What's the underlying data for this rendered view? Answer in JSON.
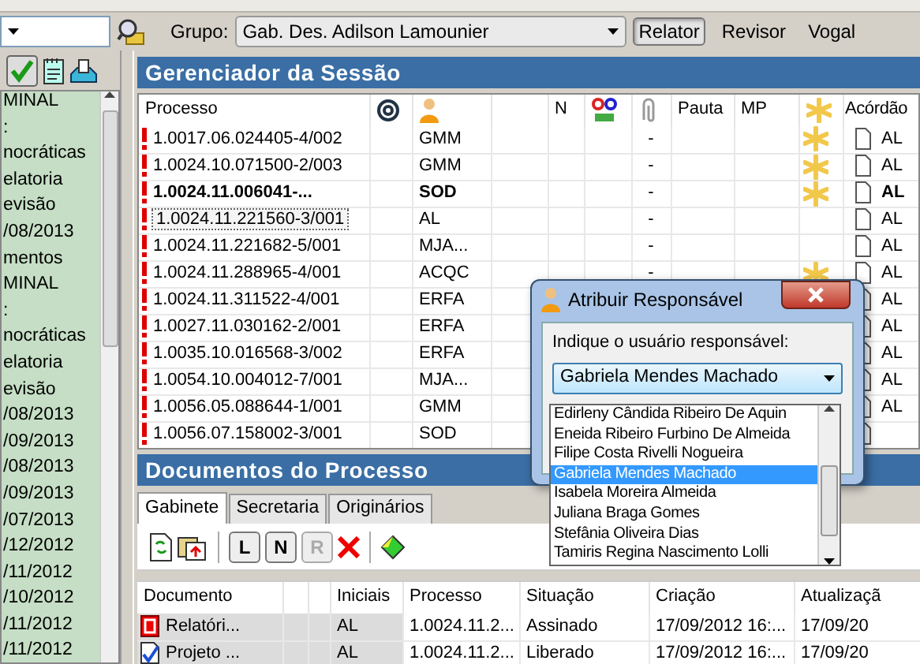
{
  "toolbar": {
    "group_label": "Grupo:",
    "group_value": "Gab. Des. Adilson Lamounier",
    "role_buttons": [
      {
        "label": "Relator",
        "selected": true
      },
      {
        "label": "Revisor",
        "selected": false
      },
      {
        "label": "Vogal",
        "selected": false
      }
    ]
  },
  "sidebar": {
    "check_pressed": true,
    "items": [
      "MINAL",
      ":",
      "nocráticas",
      "elatoria",
      "evisão",
      "/08/2013",
      "mentos",
      "MINAL",
      ":",
      "nocráticas",
      "elatoria",
      "evisão",
      "/08/2013",
      "/09/2013",
      "/08/2013",
      "/09/2013",
      "/07/2013",
      "/12/2012",
      "/11/2012",
      "/10/2012",
      "/11/2012",
      "/11/2012"
    ]
  },
  "session": {
    "title": "Gerenciador da Sessão",
    "columns": [
      {
        "kind": "text",
        "label": "Processo"
      },
      {
        "kind": "email"
      },
      {
        "kind": "person"
      },
      {
        "kind": "blank"
      },
      {
        "kind": "text",
        "label": "N"
      },
      {
        "kind": "acronym"
      },
      {
        "kind": "clip"
      },
      {
        "kind": "text",
        "label": "Pauta"
      },
      {
        "kind": "text",
        "label": "MP"
      },
      {
        "kind": "star"
      },
      {
        "kind": "text",
        "label": "Acórdão"
      }
    ],
    "rows": [
      {
        "process": "1.0017.06.024405-4/002",
        "initials": "GMM",
        "pauta": "-",
        "starred": true,
        "acordao": "AL",
        "bold": false,
        "focused": false
      },
      {
        "process": "1.0024.10.071500-2/003",
        "initials": "GMM",
        "pauta": "-",
        "starred": true,
        "acordao": "AL",
        "bold": false,
        "focused": false
      },
      {
        "process": "1.0024.11.006041-...",
        "initials": "SOD",
        "pauta": "-",
        "starred": true,
        "acordao": "AL",
        "bold": true,
        "focused": false
      },
      {
        "process": "1.0024.11.221560-3/001",
        "initials": "AL",
        "pauta": "-",
        "starred": false,
        "acordao": "AL",
        "bold": false,
        "focused": true
      },
      {
        "process": "1.0024.11.221682-5/001",
        "initials": "MJA...",
        "pauta": "-",
        "starred": false,
        "acordao": "AL",
        "bold": false,
        "focused": false
      },
      {
        "process": "1.0024.11.288965-4/001",
        "initials": "ACQC",
        "pauta": "-",
        "starred": true,
        "acordao": "AL",
        "bold": false,
        "focused": false
      },
      {
        "process": "1.0024.11.311522-4/001",
        "initials": "ERFA",
        "starred": false,
        "acordao": "AL",
        "bold": false,
        "focused": false
      },
      {
        "process": "1.0027.11.030162-2/001",
        "initials": "ERFA",
        "starred": false,
        "acordao": "AL",
        "bold": false,
        "focused": false
      },
      {
        "process": "1.0035.10.016568-3/002",
        "initials": "ERFA",
        "starred": false,
        "acordao": "AL",
        "bold": false,
        "focused": false
      },
      {
        "process": "1.0054.10.004012-7/001",
        "initials": "MJA...",
        "starred": false,
        "acordao": "AL",
        "bold": false,
        "focused": false
      },
      {
        "process": "1.0056.05.088644-1/001",
        "initials": "GMM",
        "starred": false,
        "acordao": "AL",
        "bold": false,
        "focused": false
      },
      {
        "process": "1.0056.07.158002-3/001",
        "initials": "SOD",
        "starred": false,
        "bold": false,
        "focused": false
      }
    ]
  },
  "documents": {
    "title": "Documentos do Processo",
    "tabs": [
      {
        "label": "Gabinete",
        "selected": true
      },
      {
        "label": "Secretaria",
        "selected": false
      },
      {
        "label": "Originários",
        "selected": false
      }
    ],
    "letter_buttons": [
      {
        "label": "L",
        "disabled": false
      },
      {
        "label": "N",
        "disabled": false
      },
      {
        "label": "R",
        "disabled": true
      }
    ],
    "columns": [
      "Documento",
      "",
      "",
      "Iniciais",
      "Processo",
      "Situação",
      "Criação",
      "Atualizaçã"
    ],
    "rows": [
      {
        "kind": "report",
        "name": "Relatóri...",
        "initials": "AL",
        "process": "1.0024.11.2...",
        "status": "Assinado",
        "created": "17/09/2012 16:...",
        "updated": "17/09/20"
      },
      {
        "kind": "draft",
        "name": "Projeto ...",
        "initials": "AL",
        "process": "1.0024.11.2...",
        "status": "Liberado",
        "created": "17/09/2012 16:...",
        "updated": "17/09/20"
      }
    ]
  },
  "dialog": {
    "title": "Atribuir Responsável",
    "prompt": "Indique o usuário responsável:",
    "value": "Gabriela Mendes Machado",
    "options": [
      {
        "label": "Edirleny Cândida Ribeiro De Aquin",
        "selected": false
      },
      {
        "label": "Eneida Ribeiro Furbino De Almeida",
        "selected": false
      },
      {
        "label": "Filipe Costa Rivelli Nogueira",
        "selected": false
      },
      {
        "label": "Gabriela Mendes Machado",
        "selected": true
      },
      {
        "label": "Isabela Moreira Almeida",
        "selected": false
      },
      {
        "label": "Juliana Braga Gomes",
        "selected": false
      },
      {
        "label": "Stefânia Oliveira Dias",
        "selected": false
      },
      {
        "label": "Tamiris Regina Nascimento Lolli",
        "selected": false
      }
    ]
  }
}
